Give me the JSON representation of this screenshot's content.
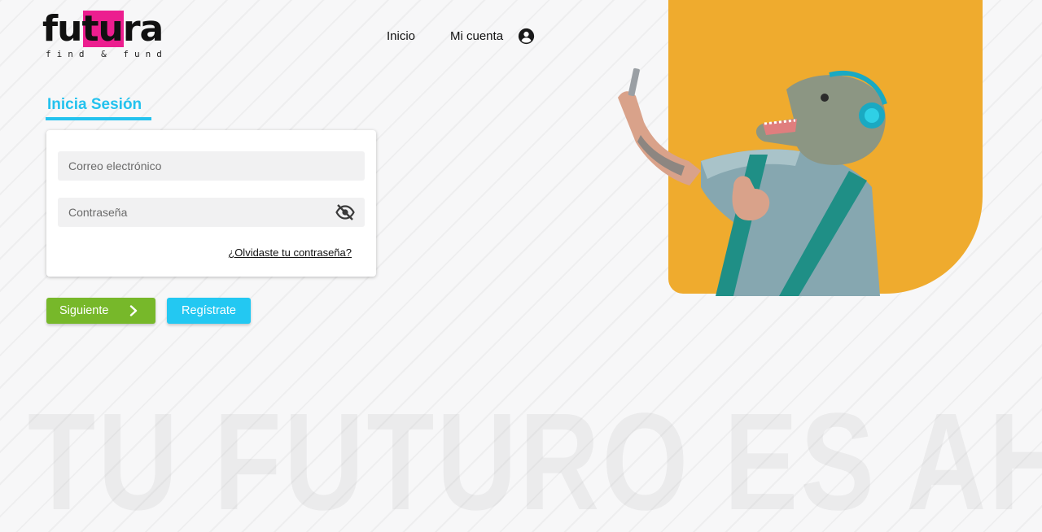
{
  "brand": {
    "name": "futura",
    "tagline": "find & fund",
    "highlight_color": "#ec1e8f"
  },
  "nav": {
    "items": [
      {
        "label": "Inicio"
      },
      {
        "label": "Mi cuenta",
        "icon": "user-circle-icon"
      }
    ]
  },
  "hero": {
    "background_color": "#efab2e",
    "image": "person-with-dinosaur-mask-taking-selfie"
  },
  "login": {
    "title": "Inicia Sesión",
    "accent_color": "#23c2ee",
    "email": {
      "placeholder": "Correo electrónico",
      "value": ""
    },
    "password": {
      "placeholder": "Contraseña",
      "value": "",
      "toggle_icon": "eye-off-icon"
    },
    "forgot_link": "¿Olvidaste tu contraseña?"
  },
  "actions": {
    "next": {
      "label": "Siguiente",
      "color": "#77b82a",
      "icon": "chevron-right-icon"
    },
    "register": {
      "label": "Regístrate",
      "color": "#23c8f2"
    }
  },
  "slogan": "TU FUTURO ES AHORA"
}
